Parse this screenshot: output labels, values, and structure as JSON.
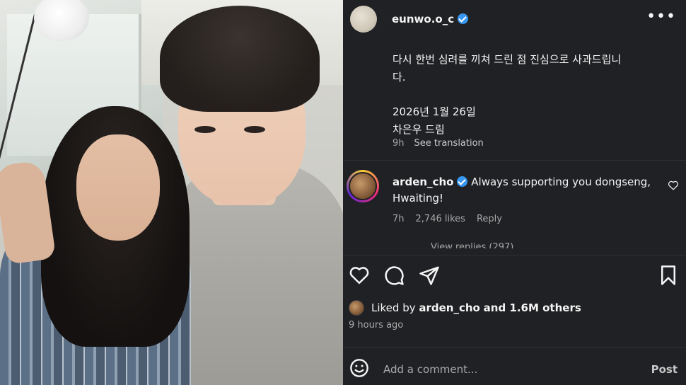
{
  "post": {
    "username": "eunwo.o_c",
    "caption_line1": "다시 한번 심려를 끼쳐 드린 점 진심으로 사과드립니",
    "caption_line2": "다.",
    "caption_date": "2026년 1월 26일",
    "caption_sign": "차은우 드림",
    "caption_age": "9h",
    "see_translation": "See translation"
  },
  "comment": {
    "username": "arden_cho",
    "text": "Always supporting you dongseng, Hwaiting!",
    "age": "7h",
    "likes": "2,746 likes",
    "reply_label": "Reply",
    "view_replies": "View replies (297)"
  },
  "likes": {
    "prefix": "Liked by",
    "user": "arden_cho",
    "suffix": "and 1.6M others",
    "time": "9 hours ago"
  },
  "comment_input": {
    "placeholder": "Add a comment...",
    "post_label": "Post"
  },
  "icons": {
    "more": "more-icon",
    "verified": "verified-badge-icon",
    "heart": "heart-icon",
    "comment": "comment-icon",
    "share": "share-icon",
    "bookmark": "bookmark-icon",
    "emoji": "emoji-icon"
  },
  "colors": {
    "panel_bg": "#202124",
    "verified_blue": "#3797f0",
    "muted_text": "#a8a8a8"
  }
}
